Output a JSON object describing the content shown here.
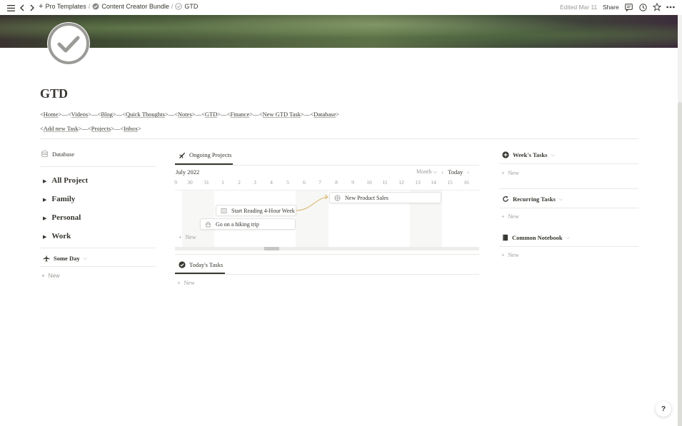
{
  "topbar": {
    "breadcrumbs": [
      "Pro Templates",
      "Content Creator Bundle",
      "GTD"
    ],
    "separator": "/",
    "edited": "Edited Mar 11",
    "share": "Share"
  },
  "page": {
    "title": "GTD",
    "links_line1": [
      "<",
      "Home",
      ">—<",
      "Videos",
      ">—<",
      "Blog",
      ">—<",
      "Quick Thoughts",
      ">—<",
      "Notes",
      ">—<",
      "GTD",
      ">—<",
      "Finance",
      ">—<",
      "New GTD Task",
      ">—<",
      "Database",
      ">"
    ],
    "links_line2": [
      "<",
      "Add new Task",
      ">—<",
      "Projects",
      ">—<",
      "Inbox",
      ">"
    ]
  },
  "left": {
    "database_label": "Database",
    "toggles": [
      "All Project",
      "Family",
      "Personal",
      "Work"
    ],
    "someday_label": "Some Day",
    "new_label": "New"
  },
  "middle": {
    "tab_label": "Ongoing Projects",
    "month_label": "July 2022",
    "view_label": "Month",
    "today_label": "Today",
    "days": [
      "9",
      "30",
      "31",
      "1",
      "2",
      "3",
      "4",
      "5",
      "6",
      "7",
      "8",
      "9",
      "10",
      "11",
      "12",
      "13",
      "14",
      "15",
      "16"
    ],
    "cards": [
      "New Product Sales",
      "Start Reading 4-Hour Week",
      "Go on a hiking trip"
    ],
    "new_label": "New",
    "todays_tab_label": "Today's Tasks",
    "todays_new_label": "New"
  },
  "right": {
    "weeks_tasks": "Week's Tasks",
    "recurring_tasks": "Recurring Tasks",
    "common_notebook": "Common Notebook",
    "new_label": "New"
  },
  "help_label": "?",
  "icons": {
    "menu": "menu-icon",
    "back": "back-arrow-icon",
    "forward": "forward-arrow-icon",
    "plus": "plus-icon",
    "comment": "comment-icon",
    "clock": "clock-icon",
    "star": "star-icon",
    "more": "more-icon",
    "page": "check-circle-icon"
  }
}
